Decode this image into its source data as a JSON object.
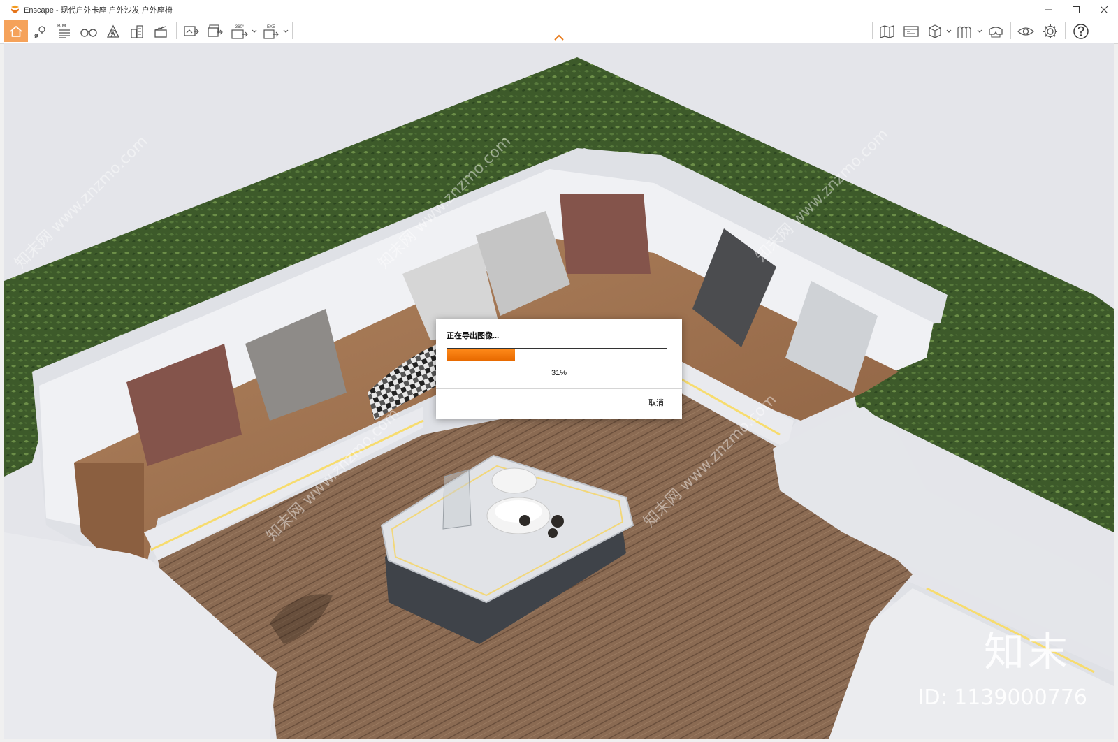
{
  "window": {
    "title": "Enscape - 现代户外卡座 户外沙发 户外座椅",
    "controls": [
      "minimize-icon",
      "maximize-icon",
      "close-icon"
    ]
  },
  "toolbar": {
    "bim_label": "BIM",
    "pano_label": "360°",
    "exe_label": "EXE",
    "left_icons": [
      "home-icon",
      "location-pin-icon",
      "bim-icon",
      "binoculars-icon",
      "tent-icon",
      "buildings-icon",
      "clapperboard-icon",
      "screenshot-export-icon",
      "batch-export-icon",
      "panorama-export-icon",
      "exe-export-icon"
    ],
    "right_icons": [
      "map-icon",
      "asset-library-icon",
      "cube-view-icon",
      "material-icon",
      "vr-headset-icon",
      "eye-icon",
      "settings-gear-icon",
      "help-icon"
    ],
    "collapse_icon": "chevron-up-icon",
    "accent_color": "#f5a25a"
  },
  "dialog": {
    "title": "正在导出图像...",
    "progress": 0.31,
    "progress_text": "31%",
    "cancel_label": "取消",
    "progress_color": "#ff8a1a"
  },
  "watermark": {
    "site": "知末网 www.znzmo.com",
    "logo": "知末",
    "id": "ID: 1139000776"
  }
}
